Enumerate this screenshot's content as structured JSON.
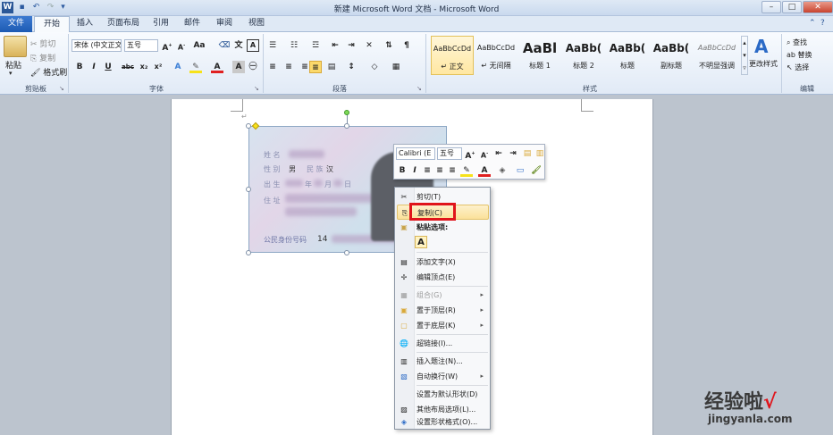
{
  "title_bar": {
    "title": "新建 Microsoft Word 文档 - Microsoft Word",
    "buttons": {
      "minimize": "–",
      "maximize": "□",
      "close": "✕"
    },
    "quick_access": [
      "W",
      "💾",
      "↶",
      "↷",
      "▾"
    ]
  },
  "tabs": [
    "文件",
    "开始",
    "插入",
    "页面布局",
    "引用",
    "邮件",
    "审阅",
    "视图"
  ],
  "ribbon": {
    "clipboard": {
      "paste": "粘贴",
      "cut": "剪切",
      "copy": "复制",
      "format_painter": "格式刷",
      "group": "剪贴板"
    },
    "font": {
      "name": "宋体 (中文正文",
      "size": "五号",
      "group": "字体"
    },
    "paragraph": {
      "group": "段落"
    },
    "styles": {
      "group": "样式",
      "items": [
        {
          "preview": "AaBbCcDd",
          "name": "↵ 正文"
        },
        {
          "preview": "AaBbCcDd",
          "name": "↵ 无间隔"
        },
        {
          "preview": "AaBl",
          "name": "标题 1"
        },
        {
          "preview": "AaBb(",
          "name": "标题 2"
        },
        {
          "preview": "AaBb(",
          "name": "标题"
        },
        {
          "preview": "AaBb(",
          "name": "副标题"
        },
        {
          "preview": "AaBbCcDd",
          "name": "不明显强调"
        }
      ],
      "change_styles": "更改样式"
    },
    "editing": {
      "find": "查找",
      "replace": "替换",
      "select": "选择",
      "group": "编辑"
    }
  },
  "id_card": {
    "name_label": "姓 名",
    "gender_label": "性 别",
    "gender_value": "男",
    "ethnicity_label": "民 族",
    "ethnicity_value": "汉",
    "birth_label": "出 生",
    "year": "年",
    "month": "月",
    "day": "日",
    "address_label": "住 址",
    "id_label": "公民身份号码",
    "id_value": "14"
  },
  "mini_toolbar": {
    "font": "Calibri (E",
    "size": "五号"
  },
  "context_menu": [
    {
      "label": "剪切(T)",
      "icon": "✂",
      "enabled": true
    },
    {
      "label": "复制(C)",
      "icon": "⎘",
      "enabled": true,
      "highlighted": true
    },
    {
      "label": "粘贴选项:",
      "icon": "📋",
      "enabled": true,
      "bold": true
    },
    {
      "label": "添加文字(X)",
      "icon": "▤",
      "enabled": true
    },
    {
      "label": "编辑顶点(E)",
      "icon": "✢",
      "enabled": true
    },
    {
      "label": "组合(G)",
      "icon": "▦",
      "enabled": false,
      "submenu": true
    },
    {
      "label": "置于顶层(R)",
      "icon": "▣",
      "enabled": true,
      "submenu": true
    },
    {
      "label": "置于底层(K)",
      "icon": "▢",
      "enabled": true,
      "submenu": true
    },
    {
      "label": "超链接(I)...",
      "icon": "🌐",
      "enabled": true
    },
    {
      "label": "插入题注(N)...",
      "icon": "▥",
      "enabled": true
    },
    {
      "label": "自动换行(W)",
      "icon": "▧",
      "enabled": true,
      "submenu": true
    },
    {
      "label": "设置为默认形状(D)",
      "icon": "",
      "enabled": true
    },
    {
      "label": "其他布局选项(L)...",
      "icon": "▨",
      "enabled": true
    },
    {
      "label": "设置形状格式(O)...",
      "icon": "◈",
      "enabled": true
    }
  ],
  "paste_option": "A",
  "watermark": {
    "text_cn": "经验啦",
    "check": "√",
    "url": "jingyanla.com"
  },
  "colors": {
    "highlight_box": "#e0141b",
    "file_tab": "#2b6ac6",
    "accent_yellow": "#fbe19a"
  }
}
